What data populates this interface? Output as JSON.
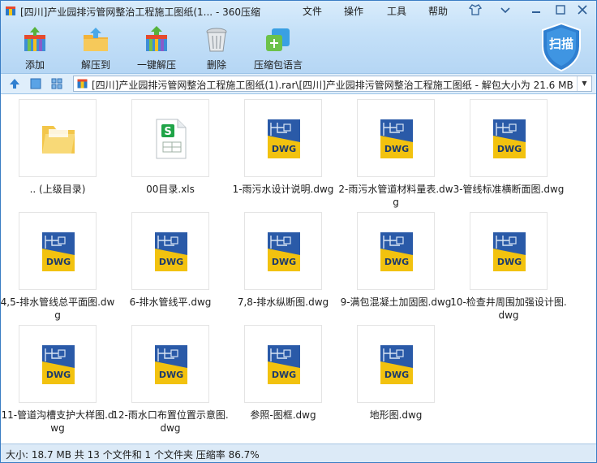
{
  "window": {
    "title": "[四川]产业园排污管网整治工程施工图纸(1... - 360压缩"
  },
  "menu": {
    "file": "文件",
    "operations": "操作",
    "tools": "工具",
    "help": "帮助"
  },
  "toolbar": {
    "add": "添加",
    "extract_to": "解压到",
    "quick_extract": "一键解压",
    "delete": "删除",
    "archive_language": "压缩包语言",
    "scan": "扫描"
  },
  "address": {
    "path": "[四川]产业园排污管网整治工程施工图纸(1).rar\\[四川]产业园排污管网整治工程施工图纸 - 解包大小为 21.6 MB"
  },
  "files": [
    {
      "name": ".. (上级目录)",
      "type": "folder-icon"
    },
    {
      "name": "00目录.xls",
      "type": "xls-file-icon"
    },
    {
      "name": "1-雨污水设计说明.dwg",
      "type": "dwg-file-icon"
    },
    {
      "name": "2-雨污水管道材料量表.dwg",
      "type": "dwg-file-icon"
    },
    {
      "name": "3-管线标准横断面图.dwg",
      "type": "dwg-file-icon"
    },
    {
      "name": "4,5-排水管线总平面图.dwg",
      "type": "dwg-file-icon"
    },
    {
      "name": "6-排水管线平.dwg",
      "type": "dwg-file-icon"
    },
    {
      "name": "7,8-排水纵断图.dwg",
      "type": "dwg-file-icon"
    },
    {
      "name": "9-满包混凝土加固图.dwg",
      "type": "dwg-file-icon"
    },
    {
      "name": "10-检查井周围加强设计图.dwg",
      "type": "dwg-file-icon"
    },
    {
      "name": "11-管道沟槽支护大样图.dwg",
      "type": "dwg-file-icon"
    },
    {
      "name": "12-雨水口布置位置示意图.dwg",
      "type": "dwg-file-icon"
    },
    {
      "name": "参照-图框.dwg",
      "type": "dwg-file-icon"
    },
    {
      "name": "地形图.dwg",
      "type": "dwg-file-icon"
    }
  ],
  "icon_labels": {
    "dwg": "DWG",
    "xls": "S",
    "scan_shield": "扫描"
  },
  "status": {
    "text": "大小: 18.7 MB 共 13 个文件和 1 个文件夹 压缩率 86.7%"
  },
  "colors": {
    "accent": "#2f7fd0",
    "dwg_yellow": "#f2c20f",
    "dwg_blue": "#2a5aa8",
    "xls_green": "#1fa447",
    "folder_yellow": "#f3c64a"
  }
}
